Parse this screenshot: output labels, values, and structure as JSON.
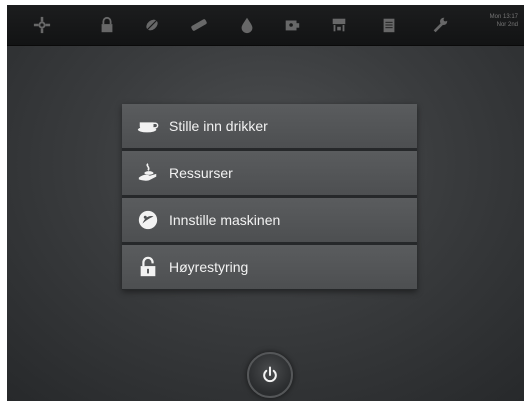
{
  "topbar": {
    "icons": [
      "settings-gear-icon",
      "lock-icon",
      "leaf-icon",
      "milk-pipe-icon",
      "water-drop-icon",
      "cup-cleaning-icon",
      "coffee-machine-icon",
      "document-icon",
      "wrench-icon"
    ],
    "clock_line1": "Mon 13:17",
    "clock_line2": "Nor 2nd"
  },
  "menu": {
    "items": [
      {
        "label": "Stille inn drikker",
        "icon": "cup-icon"
      },
      {
        "label": "Ressurser",
        "icon": "hand-coffee-icon"
      },
      {
        "label": "Innstille maskinen",
        "icon": "machine-settings-icon"
      },
      {
        "label": "Høyrestyring",
        "icon": "unlock-icon"
      }
    ]
  },
  "colors": {
    "background": "#3a3c3e",
    "menu_item": "#545658",
    "text": "#f2f2f2",
    "topbar": "#161718"
  }
}
